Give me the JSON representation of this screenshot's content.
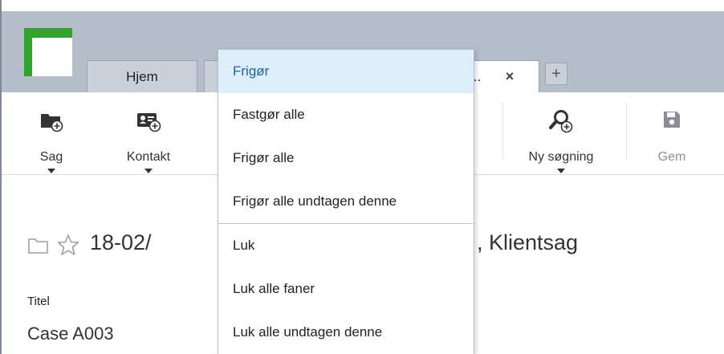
{
  "tabs": {
    "home_label": "Hjem",
    "active_label": "...",
    "close_glyph": "×",
    "add_glyph": "+"
  },
  "ribbon": {
    "sag_label": "Sag",
    "kontakt_label": "Kontakt",
    "search_label": "Ny søgning",
    "save_label": "Gem"
  },
  "case": {
    "title_left": "18-02/",
    "title_right": ", Klientsag",
    "field_label": "Titel",
    "field_value": "Case A003"
  },
  "context_menu": {
    "items": [
      {
        "label": "Frigør",
        "highlighted": true
      },
      {
        "label": "Fastgør alle"
      },
      {
        "label": "Frigør alle"
      },
      {
        "label": "Frigør alle undtagen denne"
      },
      {
        "label": "Luk"
      },
      {
        "label": "Luk alle faner"
      },
      {
        "label": "Luk alle undtagen denne"
      }
    ]
  },
  "colors": {
    "tabbar_bg": "#b5bdc8",
    "logo_green": "#2fa32a",
    "menu_highlight_bg": "#ddeefb",
    "menu_highlight_text": "#1e63b0"
  }
}
